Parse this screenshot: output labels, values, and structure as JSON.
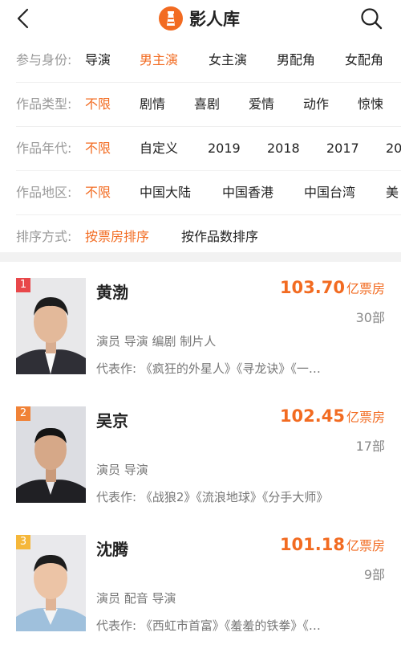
{
  "header": {
    "title": "影人库",
    "back_icon": "chevron-left-icon",
    "search_icon": "search-icon",
    "brand_color": "#f26b21"
  },
  "filters": {
    "identity": {
      "label": "参与身份:",
      "options": [
        "导演",
        "男主演",
        "女主演",
        "男配角",
        "女配角"
      ],
      "active": "男主演"
    },
    "genre": {
      "label": "作品类型:",
      "options": [
        "不限",
        "剧情",
        "喜剧",
        "爱情",
        "动作",
        "惊悚"
      ],
      "active": "不限"
    },
    "year": {
      "label": "作品年代:",
      "options": [
        "不限",
        "自定义",
        "2019",
        "2018",
        "2017",
        "20"
      ],
      "active": "不限"
    },
    "region": {
      "label": "作品地区:",
      "options": [
        "不限",
        "中国大陆",
        "中国香港",
        "中国台湾",
        "美"
      ],
      "active": "不限"
    },
    "sort": {
      "label": "排序方式:",
      "options": [
        "按票房排序",
        "按作品数排序"
      ],
      "active": "按票房排序"
    }
  },
  "people": [
    {
      "rank": "1",
      "rank_color": "#e8474a",
      "name": "黄渤",
      "box_value": "103.70",
      "box_unit": "亿票房",
      "works": "30部",
      "roles": "演员 导演 编剧 制片人",
      "representative": "代表作: 《疯狂的外星人》《寻龙诀》《一…"
    },
    {
      "rank": "2",
      "rank_color": "#f08237",
      "name": "吴京",
      "box_value": "102.45",
      "box_unit": "亿票房",
      "works": "17部",
      "roles": "演员 导演",
      "representative": "代表作: 《战狼2》《流浪地球》《分手大师》"
    },
    {
      "rank": "3",
      "rank_color": "#f5b73a",
      "name": "沈腾",
      "box_value": "101.18",
      "box_unit": "亿票房",
      "works": "9部",
      "roles": "演员 配音 导演",
      "representative": "代表作: 《西虹市首富》《羞羞的铁拳》《…"
    }
  ]
}
